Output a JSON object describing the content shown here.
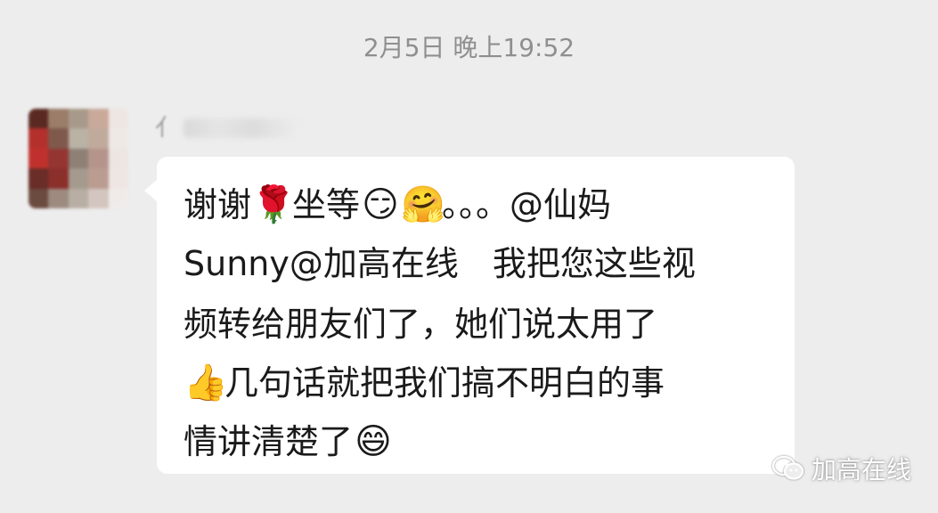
{
  "chat": {
    "timestamp": "2月5日 晚上19:52",
    "sender": {
      "name_visible_fragment": "亻",
      "avatar_colors": [
        "#5a2a22",
        "#9b7d6a",
        "#a89a8a",
        "#c9a99a",
        "#eee6e2",
        "#b3302c",
        "#7f5a4c",
        "#b9b2a5",
        "#c0aa9c",
        "#efe9e6",
        "#c0312d",
        "#943532",
        "#8e8075",
        "#b5958b",
        "#ece5e2",
        "#6a2d27",
        "#8b2f2b",
        "#a59a8e",
        "#bb9c91",
        "#ede6e3",
        "#6b4a3f",
        "#9d8b80",
        "#b8aea4",
        "#d3c6c0",
        "#f0ebe9"
      ]
    },
    "message": {
      "line1_a": "谢谢",
      "line1_rose": "🌹",
      "line1_b": "坐等",
      "line1_smirk": "😏",
      "line1_pray": "🤗",
      "line1_c": "。。。@仙妈",
      "line2": "Sunny@加高在线　我把您这些视",
      "line3": "频转给朋友们了，她们说太用了",
      "line4_thumb": "👍",
      "line4_text": "几句话就把我们搞不明白的事",
      "line5_text": "情讲清楚了",
      "line5_smile": "😄"
    }
  },
  "watermark": {
    "text": "加高在线",
    "icon": "wechat-official-account-icon"
  },
  "colors": {
    "background": "#ededed",
    "bubble": "#ffffff",
    "timestamp": "#8f8f8f",
    "text": "#1a1a1a"
  }
}
